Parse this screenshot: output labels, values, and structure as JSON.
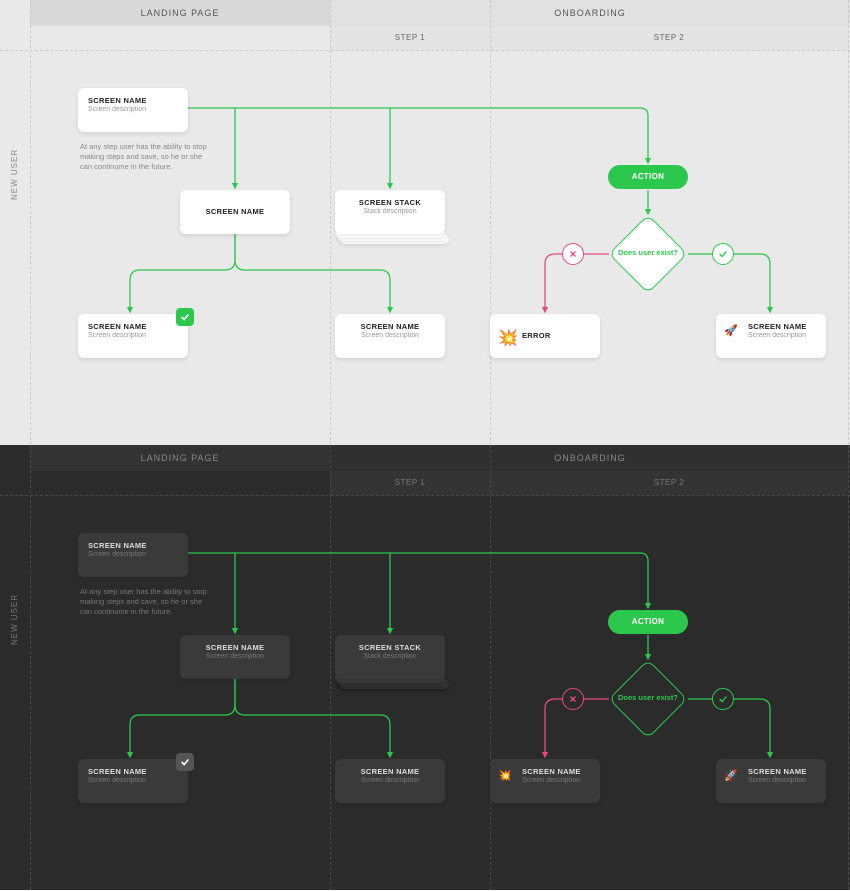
{
  "row_label": "NEW USER",
  "columns": {
    "landing": "LANDING PAGE",
    "onboarding": "ONBOARDING",
    "step1": "STEP 1",
    "step2": "STEP 2"
  },
  "note": "At any step user has the ability to stop making steps and save, so he or she can continume in the future.",
  "screens": {
    "root": {
      "title": "SCREEN NAME",
      "desc": "Screen description"
    },
    "mid": {
      "title": "SCREEN NAME",
      "desc": ""
    },
    "stack": {
      "title": "SCREEN STACK",
      "desc": "Stack description"
    },
    "leafA": {
      "title": "SCREEN NAME",
      "desc": "Screen description"
    },
    "leafB": {
      "title": "SCREEN NAME",
      "desc": "Screen description"
    },
    "error": {
      "title": "ERROR",
      "desc": ""
    },
    "success1": {
      "title": "SCREEN NAME",
      "desc": "Screen description"
    },
    "success2": {
      "title": "SCREEN NAME",
      "desc": "Screen description"
    }
  },
  "action_label": "ACTION",
  "decision_label": "Does user exist?",
  "colors": {
    "green": "#2BC84D",
    "pink": "#E84A7E"
  }
}
